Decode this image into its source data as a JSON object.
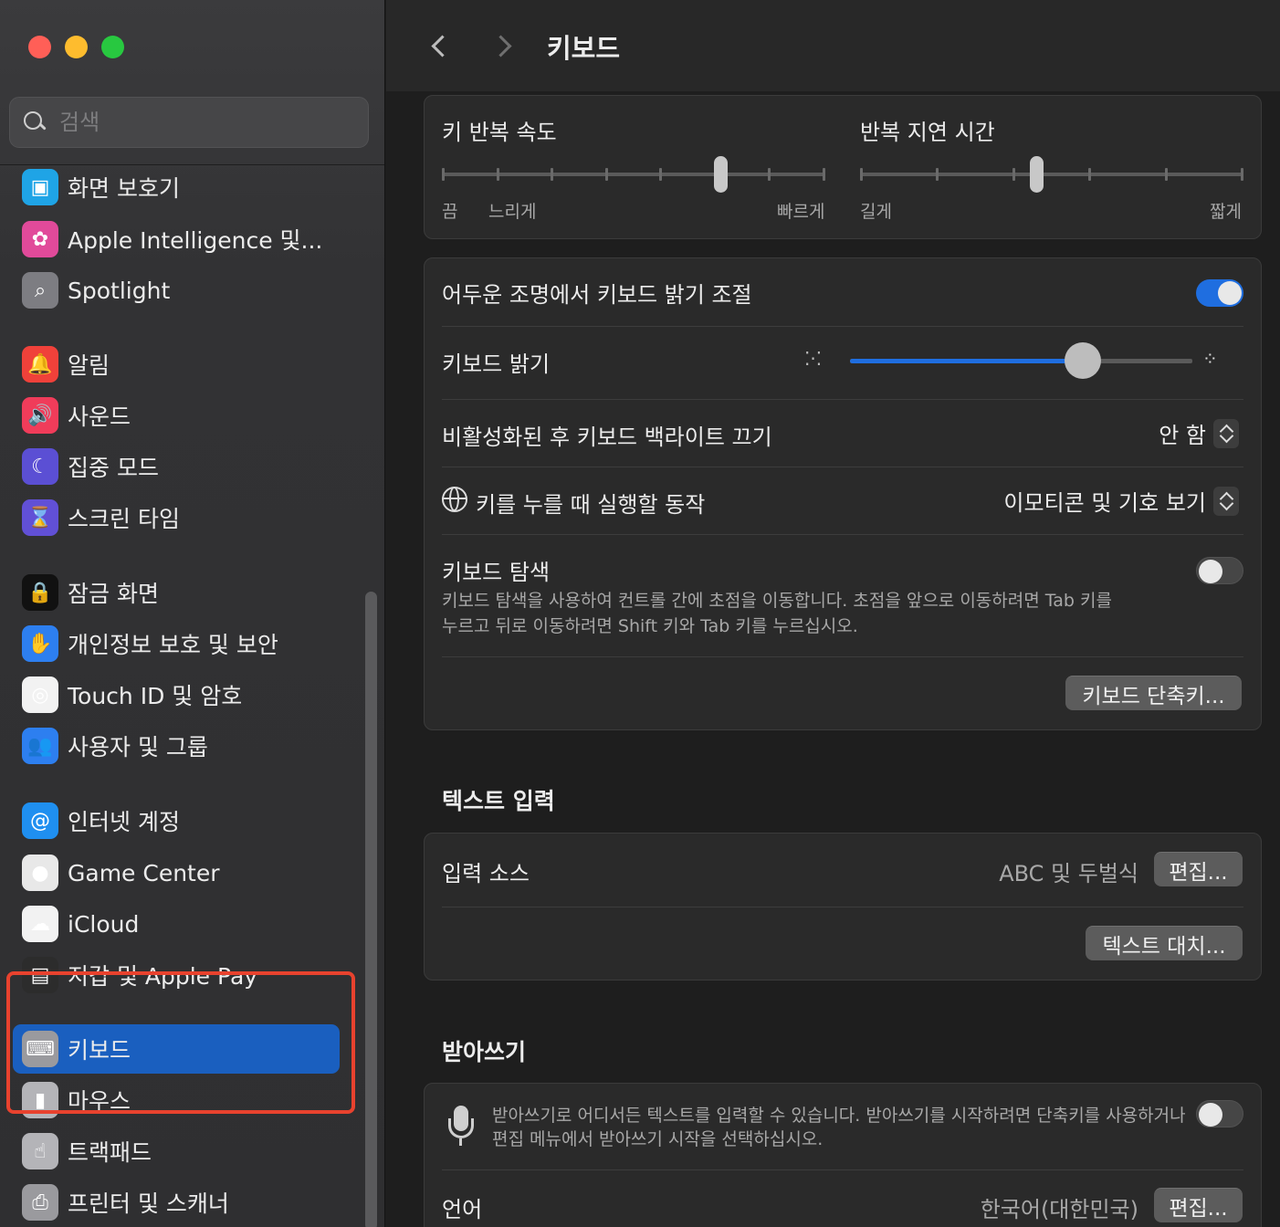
{
  "sidebar": {
    "search_placeholder": "검색",
    "items": [
      {
        "label": "화면 보호기",
        "color": "#1fa4e6",
        "glyph": "▣",
        "icon": "screensaver-icon"
      },
      {
        "label": "Apple Intelligence 및...",
        "color": "#e14a9a",
        "glyph": "✿",
        "icon": "apple-intelligence-icon"
      },
      {
        "label": "Spotlight",
        "color": "#7d7d82",
        "glyph": "⌕",
        "icon": "spotlight-icon"
      },
      {
        "label": "알림",
        "color": "#f0413a",
        "glyph": "🔔",
        "icon": "bell-icon"
      },
      {
        "label": "사운드",
        "color": "#f03c5a",
        "glyph": "🔊",
        "icon": "speaker-icon"
      },
      {
        "label": "집중 모드",
        "color": "#5b4fd4",
        "glyph": "☾",
        "icon": "moon-icon"
      },
      {
        "label": "스크린 타임",
        "color": "#6150d6",
        "glyph": "⌛",
        "icon": "hourglass-icon"
      },
      {
        "label": "잠금 화면",
        "color": "#111111",
        "glyph": "🔒",
        "icon": "lock-icon"
      },
      {
        "label": "개인정보 보호 및 보안",
        "color": "#2d7ff0",
        "glyph": "✋",
        "icon": "hand-icon"
      },
      {
        "label": "Touch ID 및 암호",
        "color": "#f2f2f2",
        "glyph": "◎",
        "icon": "fingerprint-icon"
      },
      {
        "label": "사용자 및 그룹",
        "color": "#2d7ff0",
        "glyph": "👥",
        "icon": "users-icon"
      },
      {
        "label": "인터넷 계정",
        "color": "#1f8ff0",
        "glyph": "@",
        "icon": "at-icon"
      },
      {
        "label": "Game Center",
        "color": "#e8e8e8",
        "glyph": "●",
        "icon": "game-center-icon"
      },
      {
        "label": "iCloud",
        "color": "#f2f2f2",
        "glyph": "☁",
        "icon": "cloud-icon"
      },
      {
        "label": "지갑 및 Apple Pay",
        "color": "#2c2c2c",
        "glyph": "▤",
        "icon": "wallet-icon"
      },
      {
        "label": "키보드",
        "color": "#9a9a9e",
        "glyph": "⌨",
        "icon": "keyboard-icon"
      },
      {
        "label": "마우스",
        "color": "#b4b4b8",
        "glyph": "▮",
        "icon": "mouse-icon"
      },
      {
        "label": "트랙패드",
        "color": "#b4b4b8",
        "glyph": "☝",
        "icon": "trackpad-icon"
      },
      {
        "label": "프린터 및 스캐너",
        "color": "#9a9a9e",
        "glyph": "⎙",
        "icon": "printer-icon"
      }
    ]
  },
  "main": {
    "title": "키보드",
    "key_repeat": {
      "label": "키 반복 속도",
      "labels": [
        "끔",
        "느리게",
        "빠르게"
      ],
      "ticks": 8,
      "value_step": 7
    },
    "repeat_delay": {
      "label": "반복 지연 시간",
      "labels": [
        "길게",
        "짧게"
      ],
      "ticks": 6,
      "value_step": 3
    },
    "backlight_auto": {
      "label": "어두운 조명에서 키보드 밝기 조절",
      "on": true
    },
    "brightness": {
      "label": "키보드 밝기",
      "value_percent": 68
    },
    "backlight_off": {
      "label": "비활성화된 후 키보드 백라이트 끄기",
      "value": "안 함"
    },
    "globe_key": {
      "label": "키를 누를 때 실행할 동작",
      "value": "이모티콘 및 기호 보기"
    },
    "keyboard_nav": {
      "label": "키보드 탐색",
      "desc_line1": "키보드 탐색을 사용하여 컨트롤 간에 초점을 이동합니다. 초점을 앞으로 이동하려면 Tab 키를",
      "desc_line2": "누르고 뒤로 이동하려면 Shift 키와 Tab 키를 누르십시오.",
      "on": false
    },
    "shortcuts_button": "키보드 단축키...",
    "text_input": {
      "title": "텍스트 입력",
      "input_sources_label": "입력 소스",
      "input_sources_value": "ABC 및 두벌식",
      "edit_button": "편집...",
      "text_replace_button": "텍스트 대치..."
    },
    "dictation": {
      "title": "받아쓰기",
      "desc_line1": "받아쓰기로 어디서든 텍스트를 입력할 수 있습니다. 받아쓰기를 시작하려면 단축키를 사용하거나",
      "desc_line2": "편집 메뉴에서 받아쓰기 시작을 선택하십시오.",
      "on": false,
      "language_label": "언어",
      "language_value": "한국어(대한민국)",
      "edit_button": "편집..."
    }
  }
}
